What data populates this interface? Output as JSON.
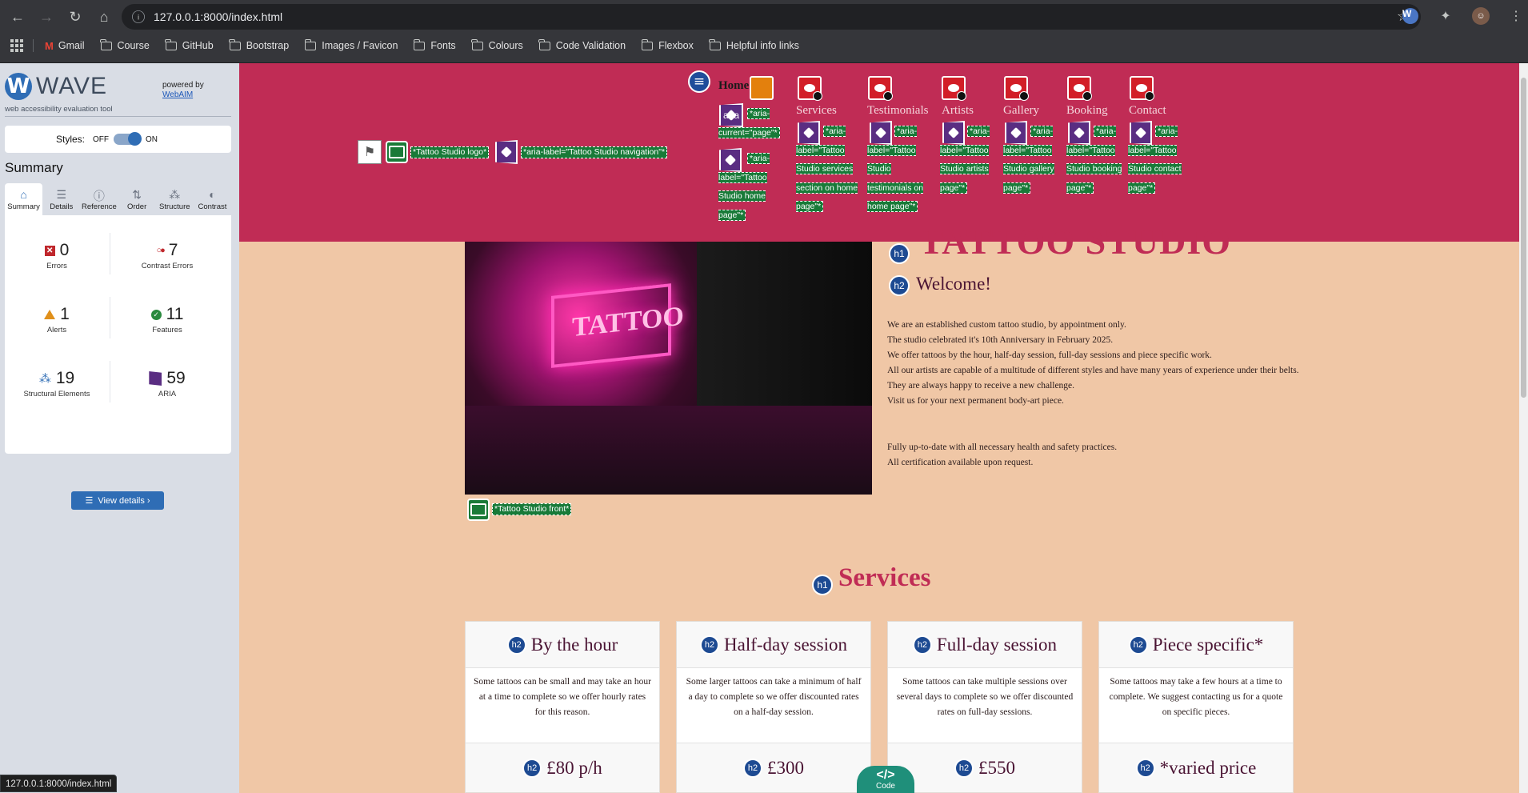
{
  "browser": {
    "url": "127.0.0.1:8000/index.html",
    "status_url": "127.0.0.1:8000/index.html",
    "bookmarks": [
      "Gmail",
      "Course",
      "GitHub",
      "Bootstrap",
      "Images / Favicon",
      "Fonts",
      "Colours",
      "Code Validation",
      "Flexbox",
      "Helpful info links"
    ]
  },
  "wave": {
    "title": "WAVE",
    "subtitle": "web accessibility evaluation tool",
    "powered_by": "powered by",
    "webaim": "WebAIM",
    "styles_label": "Styles:",
    "styles_off": "OFF",
    "styles_on": "ON",
    "summary_title": "Summary",
    "tabs": [
      "Summary",
      "Details",
      "Reference",
      "Order",
      "Structure",
      "Contrast"
    ],
    "stats": {
      "errors": {
        "count": "0",
        "label": "Errors"
      },
      "contrast_errors": {
        "count": "7",
        "label": "Contrast Errors"
      },
      "alerts": {
        "count": "1",
        "label": "Alerts"
      },
      "features": {
        "count": "11",
        "label": "Features"
      },
      "structural": {
        "count": "19",
        "label": "Structural Elements"
      },
      "aria": {
        "count": "59",
        "label": "ARIA"
      }
    },
    "view_details": "View details ›"
  },
  "site": {
    "nav": {
      "items": [
        "Home",
        "Services",
        "Testimonials",
        "Artists",
        "Gallery",
        "Booking",
        "Contact"
      ],
      "logo_tag": "*Tattoo Studio logo*",
      "nav_tag": "*aria-label=\"Tattoo Studio navigation\"*",
      "aria_badge": "aria",
      "home_current_tag": "*aria-current=\"page\"*",
      "home_tag": "*aria-label=\"Tattoo Studio home page\"*",
      "services_tag": "*aria-label=\"Tattoo Studio services section on home page\"*",
      "testimonials_tag": "*aria-label=\"Tattoo Studio testimonials on home page\"*",
      "artists_tag": "*aria-label=\"Tattoo Studio artists page\"*",
      "gallery_tag": "*aria-label=\"Tattoo Studio gallery page\"*",
      "booking_tag": "*aria-label=\"Tattoo Studio booking page\"*",
      "contact_tag": "*aria-label=\"Tattoo Studio contact page\"*"
    },
    "hero_alt_tag": "*Tattoo Studio front*",
    "hero_sign": "TATTOO",
    "h1": "TATTOO STUDIO",
    "welcome": "Welcome!",
    "about": [
      "We are an established custom tattoo studio, by appointment only.",
      "The studio celebrated it's 10th Anniversary in February 2025.",
      "We offer tattoos by the hour, half-day session, full-day sessions and piece specific work.",
      "All our artists are capable of a multitude of different styles and have many years of experience under their belts. They are always happy to receive a new challenge.",
      "Visit us for your next permanent body-art piece."
    ],
    "health": [
      "Fully up-to-date with all necessary health and safety practices.",
      "All certification available upon request."
    ],
    "services_title": "Services",
    "heading_labels": {
      "h1": "h1",
      "h2": "h2"
    },
    "services": [
      {
        "title": "By the hour",
        "text": "Some tattoos can be small and may take an hour at a time to complete so we offer hourly rates for this reason.",
        "price": "£80 p/h"
      },
      {
        "title": "Half-day session",
        "text": "Some larger tattoos can take a minimum of half a day to complete so we offer discounted rates on a half-day session.",
        "price": "£300"
      },
      {
        "title": "Full-day session",
        "text": "Some tattoos can take multiple sessions over several days to complete so we offer discounted rates on full-day sessions.",
        "price": "£550"
      },
      {
        "title": "Piece specific*",
        "text": "Some tattoos may take a few hours at a time to complete. We suggest contacting us for a quote on specific pieces.",
        "price": "*varied price"
      }
    ],
    "code_button": {
      "symbol": "</>",
      "label": "Code"
    }
  }
}
